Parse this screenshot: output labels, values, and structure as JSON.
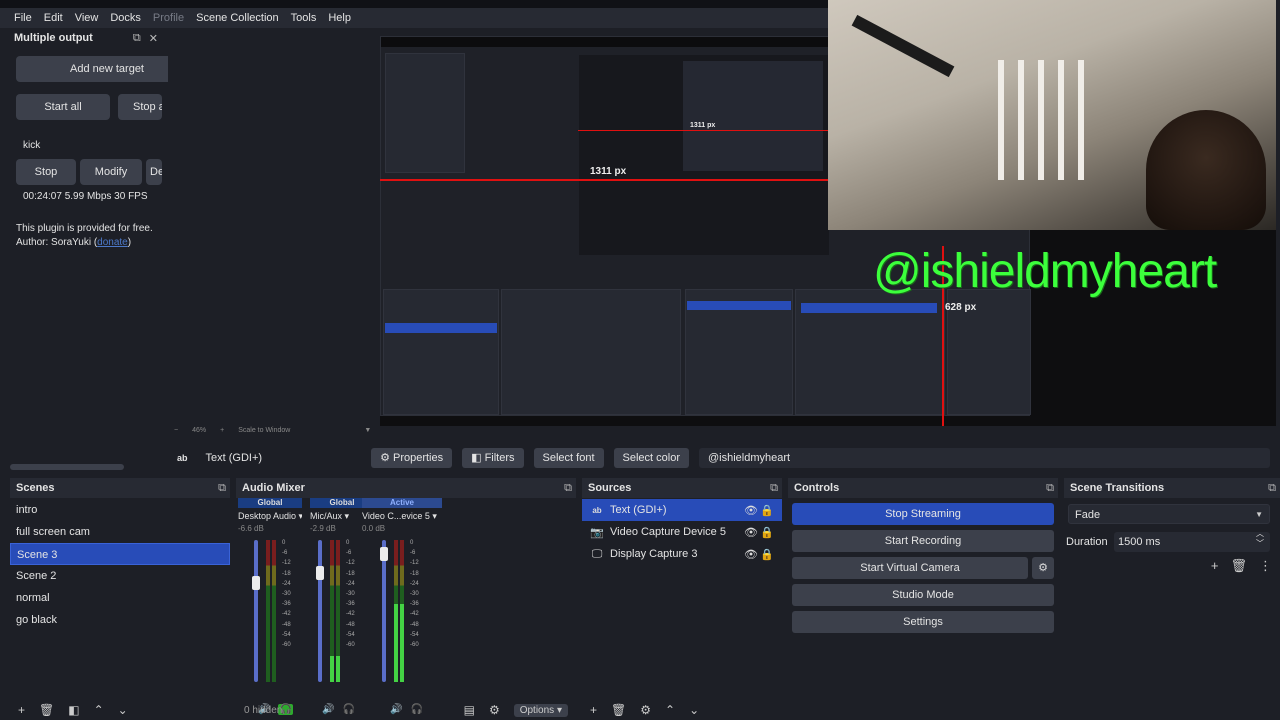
{
  "menubar": {
    "items": [
      "File",
      "Edit",
      "View",
      "Docks",
      "Profile",
      "Scene Collection",
      "Tools",
      "Help"
    ]
  },
  "multiple_output": {
    "title": "Multiple output",
    "add_target": "Add new target",
    "start_all": "Start all",
    "stop_all": "Stop a",
    "target_name": "kick",
    "stop": "Stop",
    "modify": "Modify",
    "delete": "De",
    "stats": "00:24:07  5.99 Mbps  30 FPS",
    "plugin_note": "This plugin is provided for free.",
    "author_prefix": "Author: SoraYuki (",
    "author_link": "donate",
    "author_suffix": ")"
  },
  "preview": {
    "px_label_1": "1311 px",
    "px_label_2": "628 px",
    "px_label_inner": "1311 px",
    "watermark": "@ishieldmyheart",
    "zoom": "46%",
    "scale_mode": "Scale to Window"
  },
  "source_toolbar": {
    "source_name": "Text (GDI+)",
    "properties": "Properties",
    "filters": "Filters",
    "select_font": "Select font",
    "select_color": "Select color",
    "text_value": "@ishieldmyheart"
  },
  "scenes": {
    "title": "Scenes",
    "items": [
      "intro",
      "full screen cam",
      "Scene 3",
      "Scene 2",
      "normal",
      "go black"
    ],
    "selected_index": 2
  },
  "mixer": {
    "title": "Audio Mixer",
    "channels": [
      {
        "head": "Global",
        "name": "Desktop Audio",
        "db": "-6.6 dB",
        "level": 0.0,
        "fader": 0.75
      },
      {
        "head": "Global",
        "name": "Mic/Aux",
        "db": "-2.9 dB",
        "level": 0.18,
        "fader": 0.82
      },
      {
        "head": "Active",
        "name": "Video C...evice 5",
        "db": "0.0 dB",
        "level": 0.55,
        "fader": 0.95
      }
    ],
    "scale": [
      "0",
      "-6",
      "-12",
      "-18",
      "-24",
      "-30",
      "-36",
      "-42",
      "-48",
      "-54",
      "-60"
    ],
    "footer_hidden": "0 hidden",
    "footer_options": "Options"
  },
  "sources": {
    "title": "Sources",
    "items": [
      {
        "name": "Text (GDI+)",
        "icon": "text-icon"
      },
      {
        "name": "Video Capture Device 5",
        "icon": "camera-icon"
      },
      {
        "name": "Display Capture 3",
        "icon": "monitor-icon"
      }
    ],
    "selected_index": 0
  },
  "controls": {
    "title": "Controls",
    "stop_streaming": "Stop Streaming",
    "start_recording": "Start Recording",
    "start_virtual_camera": "Start Virtual Camera",
    "studio_mode": "Studio Mode",
    "settings": "Settings"
  },
  "transitions": {
    "title": "Scene Transitions",
    "selected": "Fade",
    "duration_label": "Duration",
    "duration_value": "1500 ms"
  },
  "colors": {
    "accent": "#284cb8",
    "panel": "#272a33",
    "background": "#1d1f26",
    "watermark": "#3cff3c",
    "guide": "#e01010"
  }
}
